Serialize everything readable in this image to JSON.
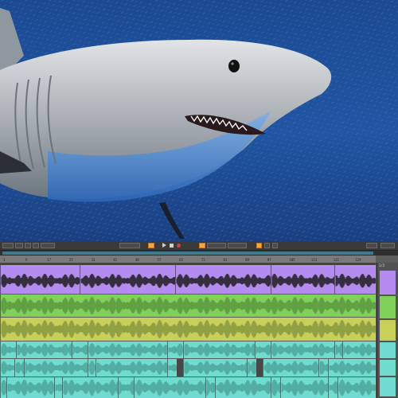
{
  "wallpaper": {
    "subject": "great-white-shark",
    "water_color": "#1f4f96",
    "shark_color": "#c8ccd1"
  },
  "transport": {
    "arrangement_view_active": true,
    "accent": "#ffa33a",
    "buttons": [
      "play-button",
      "stop-button",
      "record-button",
      "loop-button",
      "metronome-button",
      "follow-button"
    ]
  },
  "ruler": {
    "ticks": [
      "1",
      "9",
      "17",
      "25",
      "33",
      "41",
      "49",
      "57",
      "65",
      "73",
      "81",
      "89",
      "97",
      "105",
      "113",
      "121",
      "129"
    ]
  },
  "io": {
    "label": "1/2"
  },
  "tracks": [
    {
      "name": "track-1",
      "color": "#b48cf0"
    },
    {
      "name": "track-2",
      "color": "#7fd15a"
    },
    {
      "name": "track-3",
      "color": "#c9d05a"
    },
    {
      "name": "track-4",
      "color": "#6fdccf"
    },
    {
      "name": "track-5",
      "color": "#6fdccf"
    },
    {
      "name": "track-6",
      "color": "#6fdccf"
    }
  ]
}
